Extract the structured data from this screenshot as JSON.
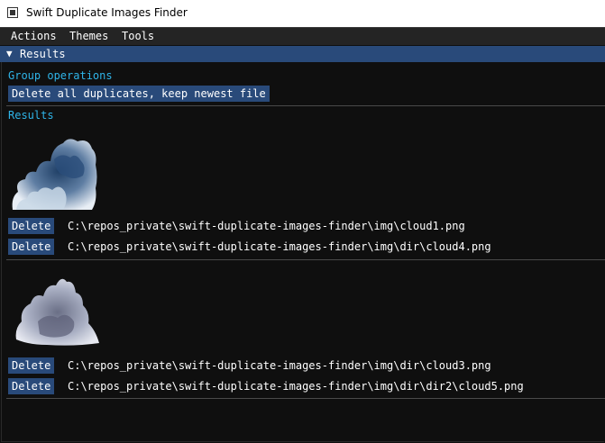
{
  "window": {
    "title": "Swift Duplicate Images Finder"
  },
  "menu": {
    "items": [
      "Actions",
      "Themes",
      "Tools"
    ]
  },
  "panel": {
    "header": "Results"
  },
  "group_ops": {
    "label": "Group operations",
    "button": "Delete all duplicates, keep newest file"
  },
  "results_label": "Results",
  "groups": [
    {
      "thumbnail": "cloud-image-1",
      "files": [
        {
          "delete_label": "Delete",
          "path": "C:\\repos_private\\swift-duplicate-images-finder\\img\\cloud1.png"
        },
        {
          "delete_label": "Delete",
          "path": "C:\\repos_private\\swift-duplicate-images-finder\\img\\dir\\cloud4.png"
        }
      ]
    },
    {
      "thumbnail": "cloud-image-2",
      "files": [
        {
          "delete_label": "Delete",
          "path": "C:\\repos_private\\swift-duplicate-images-finder\\img\\dir\\cloud3.png"
        },
        {
          "delete_label": "Delete",
          "path": "C:\\repos_private\\swift-duplicate-images-finder\\img\\dir\\dir2\\cloud5.png"
        }
      ]
    }
  ],
  "colors": {
    "accent": "#294a7a",
    "label": "#2fb4e8",
    "background": "#0f0f0f",
    "menubar": "#242424"
  }
}
